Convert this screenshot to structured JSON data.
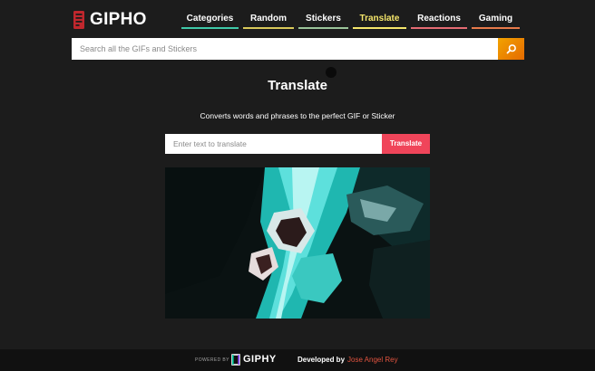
{
  "header": {
    "logo_text": "GIPHO",
    "nav": [
      {
        "label": "Categories",
        "color": "#3fc9a8",
        "active": false
      },
      {
        "label": "Random",
        "color": "#d9c95a",
        "active": false
      },
      {
        "label": "Stickers",
        "color": "#9bc49a",
        "active": false
      },
      {
        "label": "Translate",
        "color": "#f5e66b",
        "active": true
      },
      {
        "label": "Reactions",
        "color": "#e56b73",
        "active": false
      },
      {
        "label": "Gaming",
        "color": "#e87a4a",
        "active": false
      }
    ]
  },
  "search": {
    "placeholder": "Search all the GIFs and Stickers"
  },
  "main": {
    "title": "Translate",
    "subtitle": "Converts words and phrases to the perfect GIF or Sticker",
    "input_placeholder": "Enter text to translate",
    "button_label": "Translate"
  },
  "footer": {
    "powered_by": "POWERED BY",
    "giphy": "GIPHY",
    "developed_by": "Developed by",
    "developer": "Jose Angel Rey"
  },
  "colors": {
    "background": "#1c1c1c",
    "search_button": "#f2a300",
    "translate_button": "#f0455a",
    "developer_link": "#e0533f"
  }
}
